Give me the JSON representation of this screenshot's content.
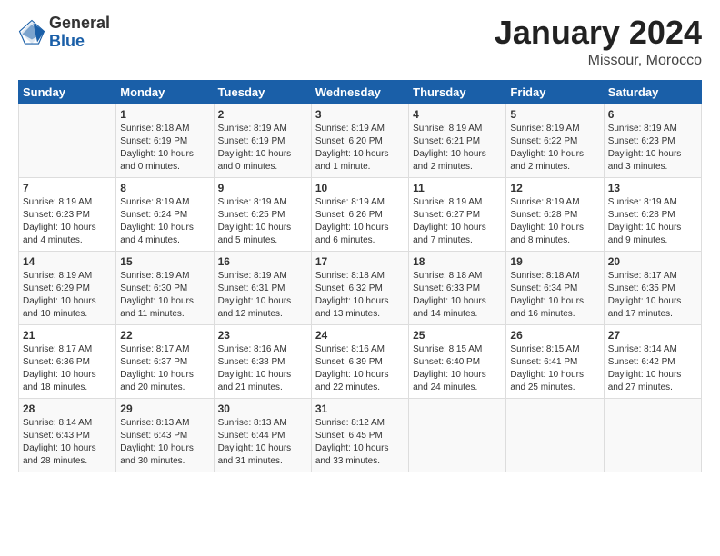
{
  "header": {
    "logo_general": "General",
    "logo_blue": "Blue",
    "month_title": "January 2024",
    "subtitle": "Missour, Morocco"
  },
  "days_of_week": [
    "Sunday",
    "Monday",
    "Tuesday",
    "Wednesday",
    "Thursday",
    "Friday",
    "Saturday"
  ],
  "weeks": [
    [
      {
        "day": "",
        "info": ""
      },
      {
        "day": "1",
        "info": "Sunrise: 8:18 AM\nSunset: 6:19 PM\nDaylight: 10 hours\nand 0 minutes."
      },
      {
        "day": "2",
        "info": "Sunrise: 8:19 AM\nSunset: 6:19 PM\nDaylight: 10 hours\nand 0 minutes."
      },
      {
        "day": "3",
        "info": "Sunrise: 8:19 AM\nSunset: 6:20 PM\nDaylight: 10 hours\nand 1 minute."
      },
      {
        "day": "4",
        "info": "Sunrise: 8:19 AM\nSunset: 6:21 PM\nDaylight: 10 hours\nand 2 minutes."
      },
      {
        "day": "5",
        "info": "Sunrise: 8:19 AM\nSunset: 6:22 PM\nDaylight: 10 hours\nand 2 minutes."
      },
      {
        "day": "6",
        "info": "Sunrise: 8:19 AM\nSunset: 6:23 PM\nDaylight: 10 hours\nand 3 minutes."
      }
    ],
    [
      {
        "day": "7",
        "info": "Sunrise: 8:19 AM\nSunset: 6:23 PM\nDaylight: 10 hours\nand 4 minutes."
      },
      {
        "day": "8",
        "info": "Sunrise: 8:19 AM\nSunset: 6:24 PM\nDaylight: 10 hours\nand 4 minutes."
      },
      {
        "day": "9",
        "info": "Sunrise: 8:19 AM\nSunset: 6:25 PM\nDaylight: 10 hours\nand 5 minutes."
      },
      {
        "day": "10",
        "info": "Sunrise: 8:19 AM\nSunset: 6:26 PM\nDaylight: 10 hours\nand 6 minutes."
      },
      {
        "day": "11",
        "info": "Sunrise: 8:19 AM\nSunset: 6:27 PM\nDaylight: 10 hours\nand 7 minutes."
      },
      {
        "day": "12",
        "info": "Sunrise: 8:19 AM\nSunset: 6:28 PM\nDaylight: 10 hours\nand 8 minutes."
      },
      {
        "day": "13",
        "info": "Sunrise: 8:19 AM\nSunset: 6:28 PM\nDaylight: 10 hours\nand 9 minutes."
      }
    ],
    [
      {
        "day": "14",
        "info": "Sunrise: 8:19 AM\nSunset: 6:29 PM\nDaylight: 10 hours\nand 10 minutes."
      },
      {
        "day": "15",
        "info": "Sunrise: 8:19 AM\nSunset: 6:30 PM\nDaylight: 10 hours\nand 11 minutes."
      },
      {
        "day": "16",
        "info": "Sunrise: 8:19 AM\nSunset: 6:31 PM\nDaylight: 10 hours\nand 12 minutes."
      },
      {
        "day": "17",
        "info": "Sunrise: 8:18 AM\nSunset: 6:32 PM\nDaylight: 10 hours\nand 13 minutes."
      },
      {
        "day": "18",
        "info": "Sunrise: 8:18 AM\nSunset: 6:33 PM\nDaylight: 10 hours\nand 14 minutes."
      },
      {
        "day": "19",
        "info": "Sunrise: 8:18 AM\nSunset: 6:34 PM\nDaylight: 10 hours\nand 16 minutes."
      },
      {
        "day": "20",
        "info": "Sunrise: 8:17 AM\nSunset: 6:35 PM\nDaylight: 10 hours\nand 17 minutes."
      }
    ],
    [
      {
        "day": "21",
        "info": "Sunrise: 8:17 AM\nSunset: 6:36 PM\nDaylight: 10 hours\nand 18 minutes."
      },
      {
        "day": "22",
        "info": "Sunrise: 8:17 AM\nSunset: 6:37 PM\nDaylight: 10 hours\nand 20 minutes."
      },
      {
        "day": "23",
        "info": "Sunrise: 8:16 AM\nSunset: 6:38 PM\nDaylight: 10 hours\nand 21 minutes."
      },
      {
        "day": "24",
        "info": "Sunrise: 8:16 AM\nSunset: 6:39 PM\nDaylight: 10 hours\nand 22 minutes."
      },
      {
        "day": "25",
        "info": "Sunrise: 8:15 AM\nSunset: 6:40 PM\nDaylight: 10 hours\nand 24 minutes."
      },
      {
        "day": "26",
        "info": "Sunrise: 8:15 AM\nSunset: 6:41 PM\nDaylight: 10 hours\nand 25 minutes."
      },
      {
        "day": "27",
        "info": "Sunrise: 8:14 AM\nSunset: 6:42 PM\nDaylight: 10 hours\nand 27 minutes."
      }
    ],
    [
      {
        "day": "28",
        "info": "Sunrise: 8:14 AM\nSunset: 6:43 PM\nDaylight: 10 hours\nand 28 minutes."
      },
      {
        "day": "29",
        "info": "Sunrise: 8:13 AM\nSunset: 6:43 PM\nDaylight: 10 hours\nand 30 minutes."
      },
      {
        "day": "30",
        "info": "Sunrise: 8:13 AM\nSunset: 6:44 PM\nDaylight: 10 hours\nand 31 minutes."
      },
      {
        "day": "31",
        "info": "Sunrise: 8:12 AM\nSunset: 6:45 PM\nDaylight: 10 hours\nand 33 minutes."
      },
      {
        "day": "",
        "info": ""
      },
      {
        "day": "",
        "info": ""
      },
      {
        "day": "",
        "info": ""
      }
    ]
  ]
}
